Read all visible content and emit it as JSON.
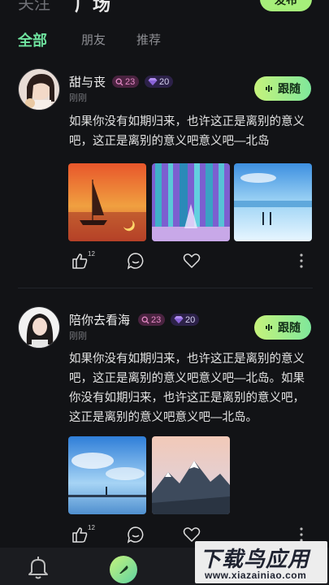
{
  "header": {
    "tab_left": "关注",
    "tab_center": "广场",
    "publish_label": "发布"
  },
  "tabs": [
    {
      "label": "全部",
      "active": true
    },
    {
      "label": "朋友",
      "active": false
    },
    {
      "label": "推荐",
      "active": false
    }
  ],
  "posts": [
    {
      "username": "甜与丧",
      "badge_level": "23",
      "badge_gems": "20",
      "time": "刚刚",
      "follow_label": "跟随",
      "content": "如果你没有如期归来，也许这正是离别的意义吧，这正是离别的意义吧意义吧—北岛",
      "photos": [
        "sunset-sailboat",
        "purple-forest",
        "snow-couple"
      ],
      "like_count": "12"
    },
    {
      "username": "陪你去看海",
      "badge_level": "23",
      "badge_gems": "20",
      "time": "刚刚",
      "follow_label": "跟随",
      "content": "如果你没有如期归来，也许这正是离别的意义吧，这正是离别的意义吧意义吧—北岛。如果你没有如期归来，也许这正是离别的意义吧，这正是离别的意义吧意义吧—北岛。",
      "photos": [
        "sky-pier",
        "snow-mountains"
      ],
      "like_count": "12"
    }
  ],
  "watermark": {
    "title": "下载鸟应用",
    "url": "www.xiazainiao.com"
  },
  "colors": {
    "accent_green": "#6fe39f",
    "follow_gradient_start": "#c6f37c",
    "background": "#121316"
  },
  "icons": [
    "like-icon",
    "comment-icon",
    "heart-icon",
    "more-icon",
    "bell-icon",
    "feather-icon",
    "search-icon",
    "gem-icon",
    "voice-icon"
  ]
}
